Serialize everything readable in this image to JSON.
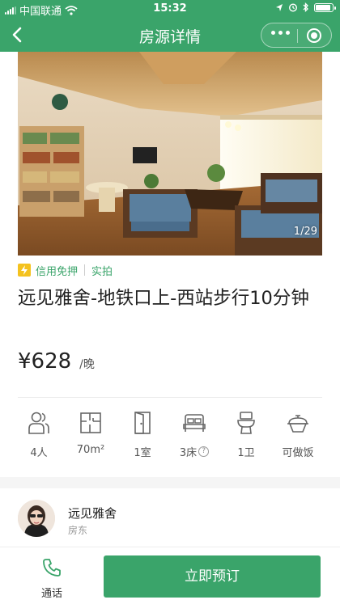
{
  "status_bar": {
    "carrier": "中国联通",
    "time": "15:32",
    "battery_level": 0.8
  },
  "nav": {
    "title": "房源详情"
  },
  "gallery": {
    "counter": "1/29"
  },
  "tags": {
    "credit": "信用免押",
    "verified": "实拍"
  },
  "listing": {
    "title": "远见雅舍-地铁口上-西站步行10分钟",
    "price": "¥628",
    "price_unit": "/晚"
  },
  "features": [
    {
      "icon": "people-icon",
      "label": "4人"
    },
    {
      "icon": "floorplan-icon",
      "label": "70m²"
    },
    {
      "icon": "door-icon",
      "label": "1室"
    },
    {
      "icon": "bed-icon",
      "label": "3床"
    },
    {
      "icon": "toilet-icon",
      "label": "1卫"
    },
    {
      "icon": "cooking-icon",
      "label": "可做饭"
    }
  ],
  "host": {
    "name": "远见雅舍",
    "role": "房东"
  },
  "actions": {
    "call": "通话",
    "book": "立即预订"
  },
  "colors": {
    "brand": "#3aa46a",
    "tag_yellow": "#f4c21f"
  }
}
